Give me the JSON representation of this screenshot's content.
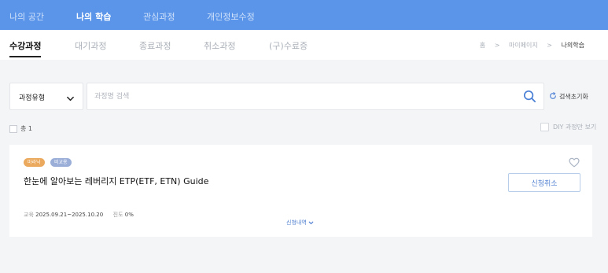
{
  "topnav": {
    "items": [
      {
        "label": "나의 공간",
        "active": false
      },
      {
        "label": "나의 학습",
        "active": true
      },
      {
        "label": "관심과정",
        "active": false
      },
      {
        "label": "개인정보수정",
        "active": false
      }
    ]
  },
  "subnav": {
    "tabs": [
      {
        "label": "수강과정",
        "active": true
      },
      {
        "label": "대기과정",
        "active": false
      },
      {
        "label": "종료과정",
        "active": false
      },
      {
        "label": "취소과정",
        "active": false
      },
      {
        "label": "(구)수료증",
        "active": false
      }
    ],
    "breadcrumb": [
      "홈",
      "마이페이지",
      "나의학습"
    ],
    "breadcrumb_sep": ">"
  },
  "search": {
    "type_label": "과정유형",
    "placeholder": "과정명 검색",
    "value": "",
    "reset_label": "검색초기화"
  },
  "list": {
    "total_label": "총 1",
    "diy_label": "DIY 과정만 보기"
  },
  "course": {
    "badges": [
      "마라닉",
      "비교용"
    ],
    "title": "한눈에 알아보는 레버리지 ETP(ETF, ETN) Guide",
    "cancel_label": "신청취소",
    "period_label": "교육",
    "period_value": "2025.09.21~2025.10.20",
    "progress_label": "진도",
    "progress_value": "0%",
    "history_label": "신청내역"
  },
  "colors": {
    "nav_bg": "#5a95ea",
    "accent": "#4f7fd0",
    "badge_orange": "#eba95d",
    "badge_blue": "#9aaed8"
  },
  "icons": {
    "select_chevron": "chevron-down-icon",
    "search": "search-icon",
    "reset": "refresh-icon",
    "favorite": "heart-icon",
    "history_chevron": "chevron-down-icon"
  }
}
